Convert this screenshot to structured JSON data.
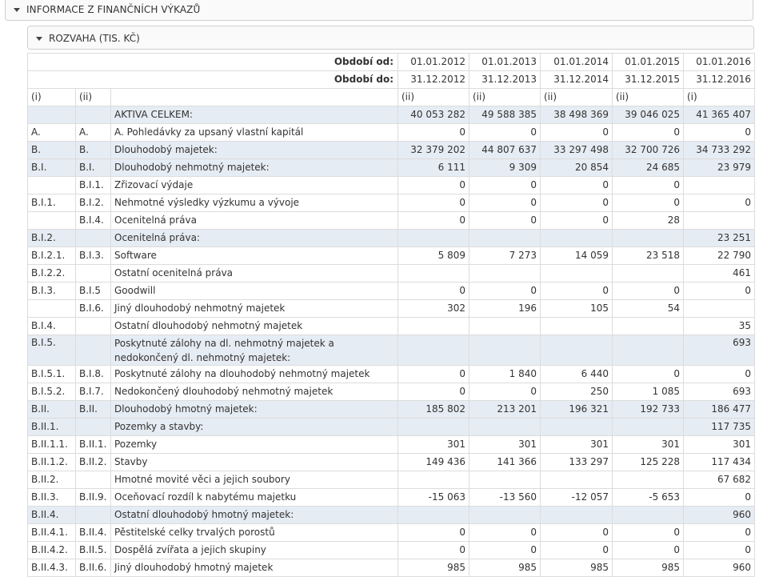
{
  "panels": {
    "outer_title": "INFORMACE Z FINANČNÍCH VÝKAZŮ",
    "inner_title": "ROZVAHA (TIS. KČ)"
  },
  "table": {
    "period_from_label": "Období od:",
    "period_to_label": "Období do:",
    "period_from": [
      "01.01.2012",
      "01.01.2013",
      "01.01.2014",
      "01.01.2015",
      "01.01.2016"
    ],
    "period_to": [
      "31.12.2012",
      "31.12.2013",
      "31.12.2014",
      "31.12.2015",
      "31.12.2016"
    ],
    "note_row": {
      "c1": "(i)",
      "c2": "(ii)",
      "vals": [
        "(ii)",
        "(ii)",
        "(ii)",
        "(ii)",
        "(i)"
      ]
    },
    "rows": [
      {
        "c1": "",
        "c2": "",
        "name": "AKTIVA CELKEM:",
        "hl": true,
        "vals": [
          "40 053 282",
          "49 588 385",
          "38 498 369",
          "39 046 025",
          "41 365 407"
        ]
      },
      {
        "c1": "A.",
        "c2": "A.",
        "name": "A. Pohledávky za upsaný vlastní kapitál",
        "hl": false,
        "vals": [
          "0",
          "0",
          "0",
          "0",
          "0"
        ]
      },
      {
        "c1": "B.",
        "c2": "B.",
        "name": "Dlouhodobý majetek:",
        "hl": true,
        "vals": [
          "32 379 202",
          "44 807 637",
          "33 297 498",
          "32 700 726",
          "34 733 292"
        ]
      },
      {
        "c1": "B.I.",
        "c2": "B.I.",
        "name": "Dlouhodobý nehmotný majetek:",
        "hl": true,
        "vals": [
          "6 111",
          "9 309",
          "20 854",
          "24 685",
          "23 979"
        ]
      },
      {
        "c1": "",
        "c2": "B.I.1.",
        "name": "Zřizovací výdaje",
        "hl": false,
        "vals": [
          "0",
          "0",
          "0",
          "0",
          ""
        ]
      },
      {
        "c1": "B.I.1.",
        "c2": "B.I.2.",
        "name": "Nehmotné výsledky výzkumu a vývoje",
        "hl": false,
        "vals": [
          "0",
          "0",
          "0",
          "0",
          "0"
        ]
      },
      {
        "c1": "",
        "c2": "B.I.4.",
        "name": "Ocenitelná práva",
        "hl": false,
        "vals": [
          "0",
          "0",
          "0",
          "28",
          ""
        ]
      },
      {
        "c1": "B.I.2.",
        "c2": "",
        "name": "Ocenitelná práva:",
        "hl": true,
        "vals": [
          "",
          "",
          "",
          "",
          "23 251"
        ]
      },
      {
        "c1": "B.I.2.1.",
        "c2": "B.I.3.",
        "name": "Software",
        "hl": false,
        "vals": [
          "5 809",
          "7 273",
          "14 059",
          "23 518",
          "22 790"
        ]
      },
      {
        "c1": "B.I.2.2.",
        "c2": "",
        "name": "Ostatní ocenitelná práva",
        "hl": false,
        "vals": [
          "",
          "",
          "",
          "",
          "461"
        ]
      },
      {
        "c1": "B.I.3.",
        "c2": "B.I.5",
        "name": "Goodwill",
        "hl": false,
        "vals": [
          "0",
          "0",
          "0",
          "0",
          "0"
        ]
      },
      {
        "c1": "",
        "c2": "B.I.6.",
        "name": "Jiný dlouhodobý nehmotný majetek",
        "hl": false,
        "vals": [
          "302",
          "196",
          "105",
          "54",
          ""
        ]
      },
      {
        "c1": "B.I.4.",
        "c2": "",
        "name": "Ostatní dlouhodobý nehmotný majetek",
        "hl": false,
        "vals": [
          "",
          "",
          "",
          "",
          "35"
        ]
      },
      {
        "c1": "B.I.5.",
        "c2": "",
        "name": "Poskytnuté zálohy na dl. nehmotný majetek a nedokončený dl. nehmotný majetek:",
        "hl": true,
        "tall": true,
        "vals": [
          "",
          "",
          "",
          "",
          "693"
        ]
      },
      {
        "c1": "B.I.5.1.",
        "c2": "B.I.8.",
        "name": "Poskytnuté zálohy na dlouhodobý nehmotný majetek",
        "hl": false,
        "vals": [
          "0",
          "1 840",
          "6 440",
          "0",
          "0"
        ]
      },
      {
        "c1": "B.I.5.2.",
        "c2": "B.I.7.",
        "name": "Nedokončený dlouhodobý nehmotný majetek",
        "hl": false,
        "vals": [
          "0",
          "0",
          "250",
          "1 085",
          "693"
        ]
      },
      {
        "c1": "B.II.",
        "c2": "B.II.",
        "name": "Dlouhodobý hmotný majetek:",
        "hl": true,
        "vals": [
          "185 802",
          "213 201",
          "196 321",
          "192 733",
          "186 477"
        ]
      },
      {
        "c1": "B.II.1.",
        "c2": "",
        "name": "Pozemky a stavby:",
        "hl": true,
        "vals": [
          "",
          "",
          "",
          "",
          "117 735"
        ]
      },
      {
        "c1": "B.II.1.1.",
        "c2": "B.II.1.",
        "name": "Pozemky",
        "hl": false,
        "vals": [
          "301",
          "301",
          "301",
          "301",
          "301"
        ]
      },
      {
        "c1": "B.II.1.2.",
        "c2": "B.II.2.",
        "name": "Stavby",
        "hl": false,
        "vals": [
          "149 436",
          "141 366",
          "133 297",
          "125 228",
          "117 434"
        ]
      },
      {
        "c1": "B.II.2.",
        "c2": "",
        "name": "Hmotné movité věci a jejich soubory",
        "hl": false,
        "vals": [
          "",
          "",
          "",
          "",
          "67 682"
        ]
      },
      {
        "c1": "B.II.3.",
        "c2": "B.II.9.",
        "name": "Oceňovací rozdíl k nabytému majetku",
        "hl": false,
        "vals": [
          "-15 063",
          "-13 560",
          "-12 057",
          "-5 653",
          "0"
        ]
      },
      {
        "c1": "B.II.4.",
        "c2": "",
        "name": "Ostatní dlouhodobý hmotný majetek:",
        "hl": true,
        "vals": [
          "",
          "",
          "",
          "",
          "960"
        ]
      },
      {
        "c1": "B.II.4.1.",
        "c2": "B.II.4.",
        "name": "Pěstitelské celky trvalých porostů",
        "hl": false,
        "vals": [
          "0",
          "0",
          "0",
          "0",
          "0"
        ]
      },
      {
        "c1": "B.II.4.2.",
        "c2": "B.II.5.",
        "name": "Dospělá zvířata a jejich skupiny",
        "hl": false,
        "vals": [
          "0",
          "0",
          "0",
          "0",
          "0"
        ]
      },
      {
        "c1": "B.II.4.3.",
        "c2": "B.II.6.",
        "name": "Jiný dlouhodobý hmotný majetek",
        "hl": false,
        "vals": [
          "985",
          "985",
          "985",
          "985",
          "960"
        ]
      }
    ]
  }
}
